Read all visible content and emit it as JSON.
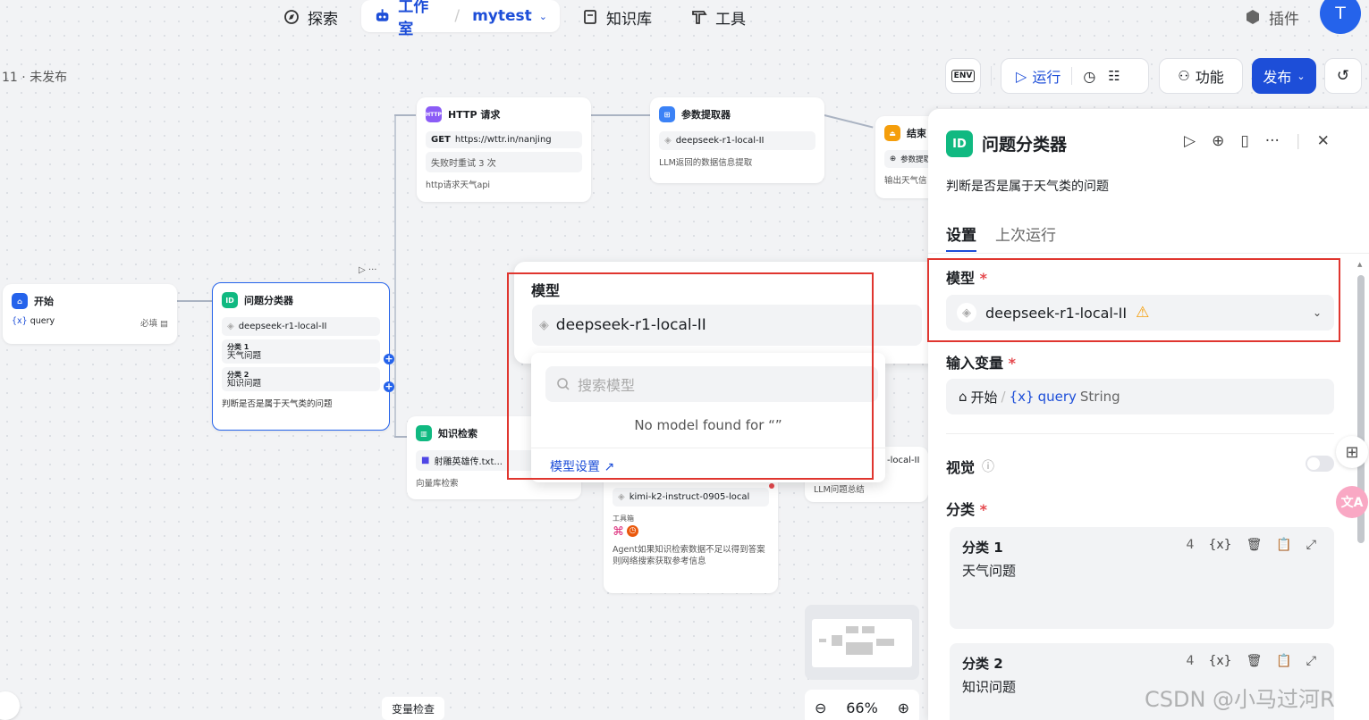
{
  "nav": {
    "explore": "探索",
    "workspace": "工作室",
    "project": "mytest",
    "knowledge": "知识库",
    "tools": "工具",
    "plugins": "插件",
    "avatar": "T"
  },
  "canvas": {
    "status": "11 · 未发布",
    "zoom": "66%",
    "var_check": "变量检查"
  },
  "toolbar": {
    "env": "ENV",
    "run": "运行",
    "features": "功能",
    "publish": "发布"
  },
  "nodes": {
    "start": {
      "title": "开始",
      "var": "query",
      "required": "必填"
    },
    "classifier": {
      "title": "问题分类器",
      "model": "deepseek-r1-local-II",
      "class1_label": "分类 1",
      "class1_value": "天气问题",
      "class2_label": "分类 2",
      "class2_value": "知识问题",
      "desc": "判断是否是属于天气类的问题"
    },
    "http": {
      "title": "HTTP 请求",
      "method": "GET",
      "url": "https://wttr.in/nanjing",
      "retry": "失败时重试 3 次",
      "desc": "http请求天气api"
    },
    "extractor": {
      "title": "参数提取器",
      "model": "deepseek-r1-local-II",
      "desc": "LLM返回的数据信息提取"
    },
    "end": {
      "title": "结束",
      "var": "参数提取",
      "desc": "输出天气信"
    },
    "knowledge": {
      "title": "知识检索",
      "dataset": "射雕英雄传.txt...",
      "desc": "向量库检索"
    },
    "agent": {
      "model": "kimi-k2-instruct-0905-local",
      "tools_label": "工具箱",
      "desc": "Agent如果知识检索数据不足以得到答案则网络搜索获取参考信息"
    },
    "llm": {
      "model": "-local-II",
      "desc": "LLM问题总结"
    }
  },
  "model_popup": {
    "label": "模型",
    "selected": "deepseek-r1-local-II",
    "search_placeholder": "搜索模型",
    "empty": "No model found for “”",
    "settings_link": "模型设置"
  },
  "panel": {
    "title": "问题分类器",
    "desc": "判断是否是属于天气类的问题",
    "tab_settings": "设置",
    "tab_last_run": "上次运行",
    "model_label": "模型",
    "required_mark": "*",
    "model_value": "deepseek-r1-local-II",
    "input_label": "输入变量",
    "input_node": "开始",
    "input_sep": "/",
    "input_var": "query",
    "input_type": "String",
    "vision_label": "视觉",
    "class_label": "分类",
    "classes": [
      {
        "title": "分类 1",
        "count": "4",
        "text": "天气问题"
      },
      {
        "title": "分类 2",
        "count": "4",
        "text": "知识问题"
      }
    ]
  },
  "watermark": "CSDN @小马过河R",
  "colors": {
    "accent": "#1d4ed8",
    "highlight": "#e0362f",
    "classifier": "#10b981",
    "http": "#8b5cf6",
    "end": "#f59e0b"
  }
}
